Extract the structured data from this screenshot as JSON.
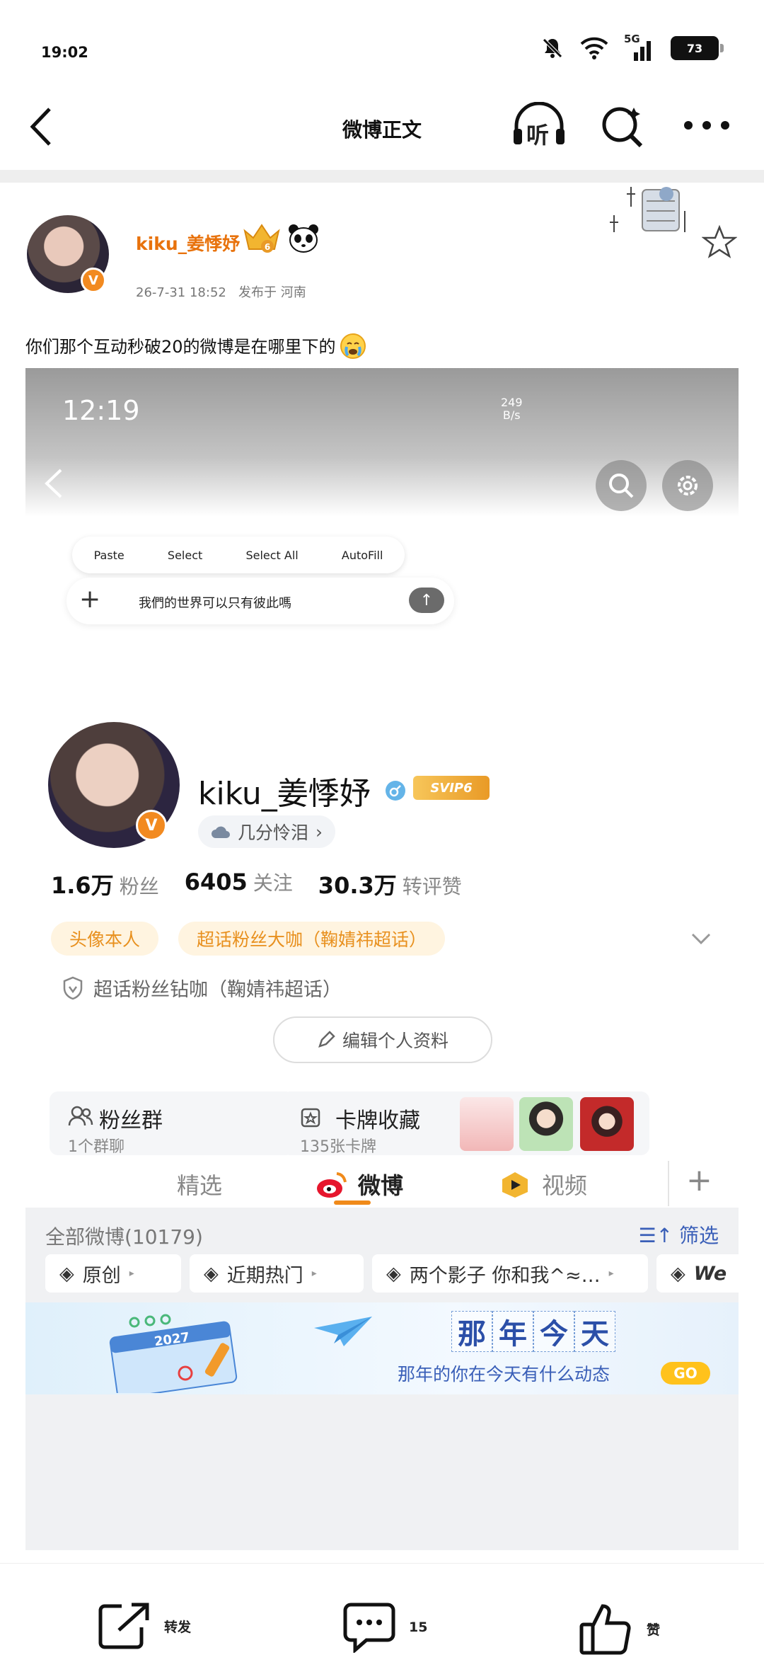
{
  "status_bar": {
    "time": "19:02",
    "battery": "73",
    "network": "5G"
  },
  "nav": {
    "title": "微博正文",
    "listen_label": "听"
  },
  "post": {
    "user_name": "kiku_姜悸妤",
    "meta_time": "26-7-31 18:52",
    "meta_location": "发布于 河南",
    "text": "你们那个互动秒破20的微博是在哪里下的"
  },
  "screenshot": {
    "time": "12:19",
    "speed_value": "249",
    "speed_unit": "B/s",
    "paste_menu": [
      "Paste",
      "Select",
      "Select All",
      "AutoFill"
    ],
    "input_value": "我們的世界可以只有彼此嗎",
    "profile": {
      "name": "kiku_姜悸妤",
      "svip": "SVIP6",
      "group_tag": "几分怜泪",
      "stats": [
        {
          "value": "1.6万",
          "label": "粉丝"
        },
        {
          "value": "6405",
          "label": "关注"
        },
        {
          "value": "30.3万",
          "label": "转评赞"
        }
      ],
      "tags": [
        "头像本人",
        "超话粉丝大咖（鞠婧祎超话）"
      ],
      "honor": "超话粉丝钻咖（鞠婧祎超话）",
      "edit_button": "编辑个人资料",
      "fan_group": {
        "title": "粉丝群",
        "sub": "1个群聊"
      },
      "card_collection": {
        "title": "卡牌收藏",
        "sub": "135张卡牌"
      }
    },
    "tabs": [
      "精选",
      "微博",
      "视频"
    ],
    "active_tab": 1,
    "feed": {
      "title": "全部微博(10179)",
      "filter": "筛选",
      "chips": [
        "原创",
        "近期热门",
        "两个影子 你和我^≈…",
        "We"
      ]
    },
    "banner": {
      "chars": [
        "那",
        "年",
        "今",
        "天"
      ],
      "subtitle": "那年的你在今天有什么动态",
      "go": "GO",
      "calendar_year": "2027"
    }
  },
  "bottom_bar": {
    "repost": "转发",
    "comments": "15",
    "like": "赞"
  },
  "colors": {
    "accent": "#f08a1a",
    "name_orange": "#e8720c",
    "link_blue": "#3a5fb8"
  }
}
